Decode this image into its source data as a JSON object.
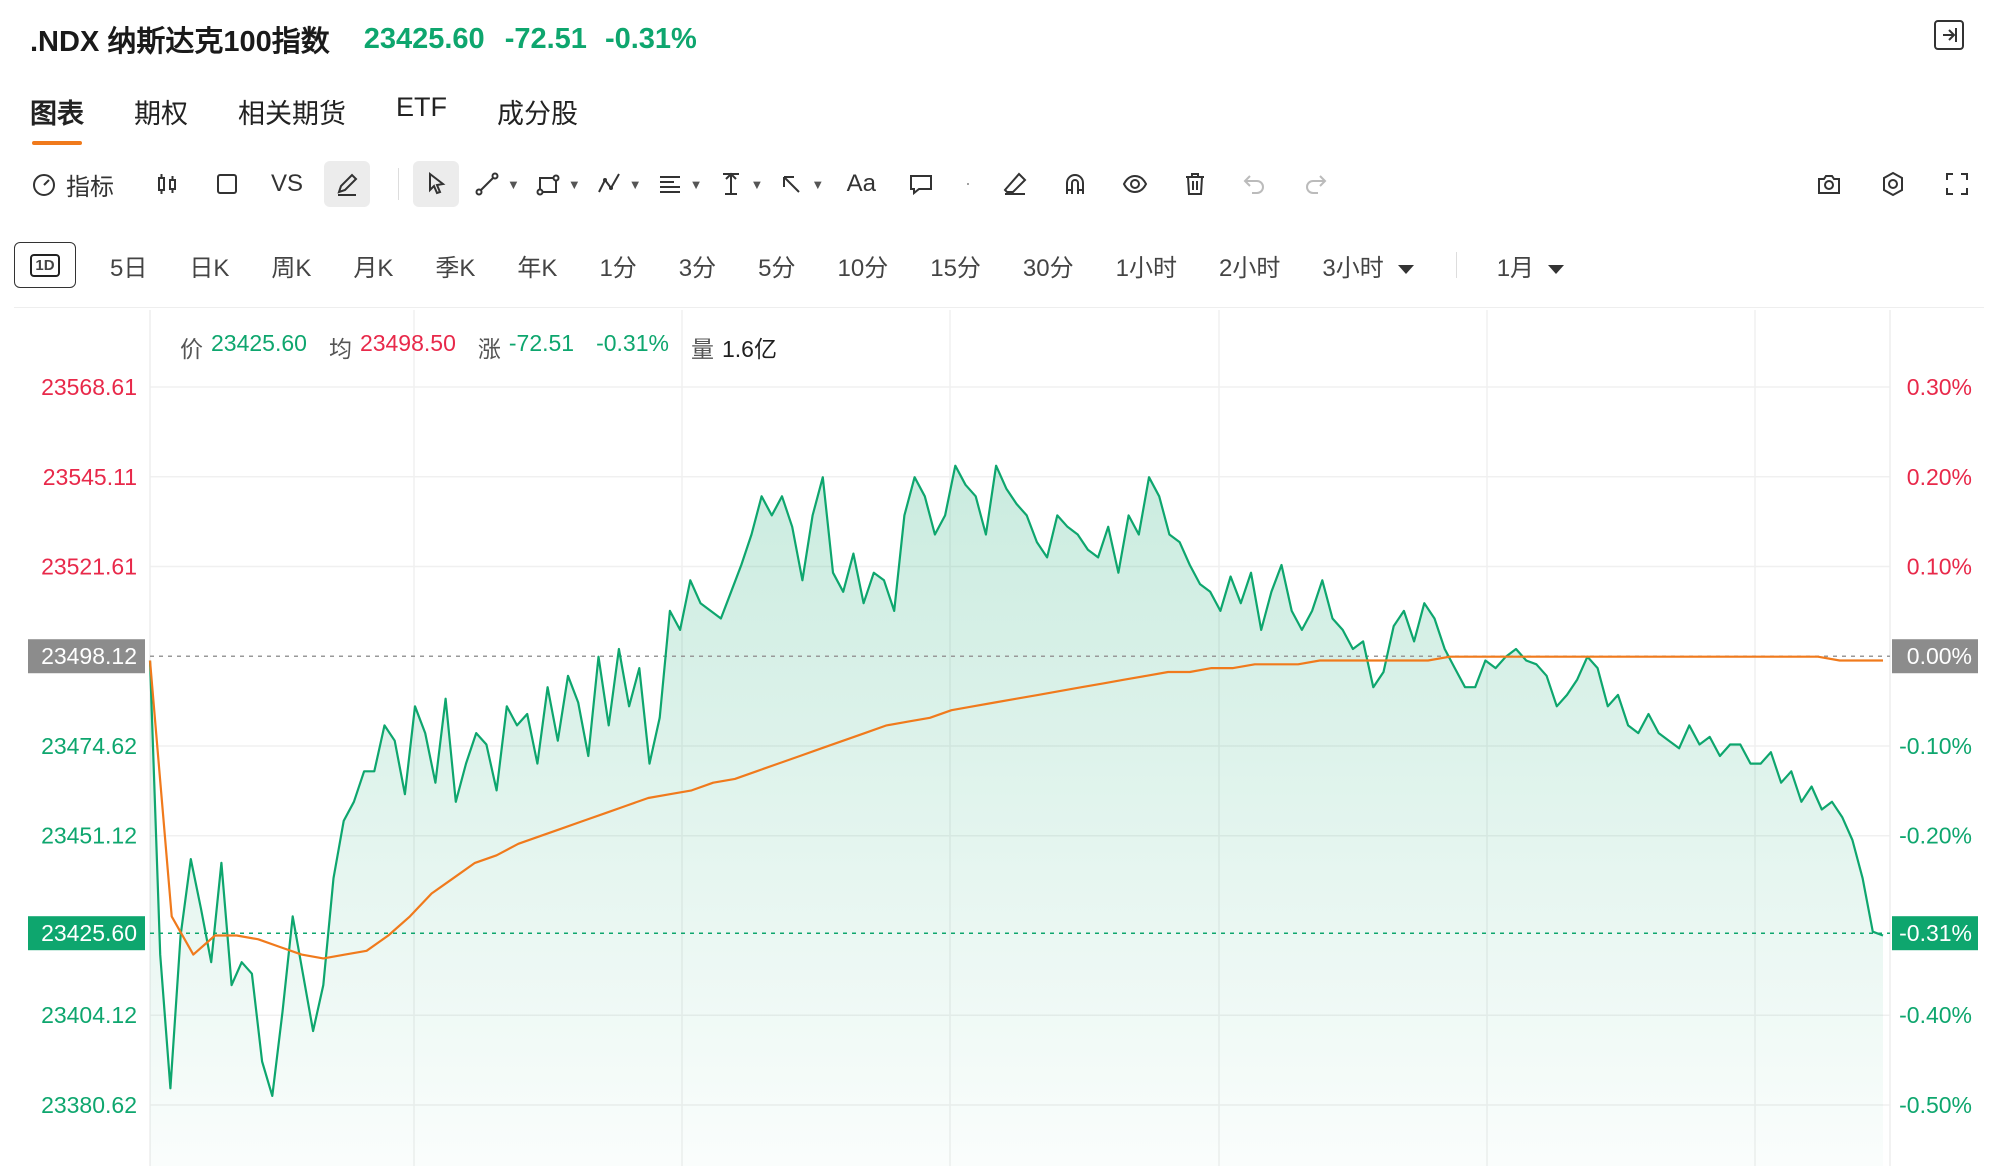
{
  "header": {
    "ticker": ".NDX 纳斯达克100指数",
    "price": "23425.60",
    "change": "-72.51",
    "change_pct": "-0.31%"
  },
  "tabs": [
    {
      "label": "图表",
      "active": true
    },
    {
      "label": "期权",
      "active": false
    },
    {
      "label": "相关期货",
      "active": false
    },
    {
      "label": "ETF",
      "active": false
    },
    {
      "label": "成分股",
      "active": false
    }
  ],
  "toolbar": {
    "indicator_label": "指标",
    "vs_label": "VS",
    "text_tool_label": "Aa"
  },
  "periods": [
    {
      "label": "1D",
      "active": true
    },
    {
      "label": "5日"
    },
    {
      "label": "日K"
    },
    {
      "label": "周K"
    },
    {
      "label": "月K"
    },
    {
      "label": "季K"
    },
    {
      "label": "年K"
    },
    {
      "label": "1分"
    },
    {
      "label": "3分"
    },
    {
      "label": "5分"
    },
    {
      "label": "10分"
    },
    {
      "label": "15分"
    },
    {
      "label": "30分"
    },
    {
      "label": "1小时"
    },
    {
      "label": "2小时"
    },
    {
      "label": "3小时"
    }
  ],
  "period_dropdown": "1月",
  "legend": {
    "price_label": "价",
    "price_value": "23425.60",
    "avg_label": "均",
    "avg_value": "23498.50",
    "chg_label": "涨",
    "chg_value": "-72.51",
    "chg_pct": "-0.31%",
    "vol_label": "量",
    "vol_value": "1.6亿"
  },
  "colors": {
    "up": "#e8294a",
    "down": "#0ea66e",
    "avg_line": "#f07a1c",
    "accent": "#f07a1c"
  },
  "chart_data": {
    "type": "area",
    "ylim": [
      23380.62,
      23568.61
    ],
    "prev_close": 23498.12,
    "last_price": 23425.6,
    "y_ticks_left": [
      "23568.61",
      "23545.11",
      "23521.61",
      "23498.12",
      "23474.62",
      "23451.12",
      "23425.60",
      "23404.12",
      "23380.62"
    ],
    "y_tick_values": [
      23568.61,
      23545.11,
      23521.61,
      23498.12,
      23474.62,
      23451.12,
      23425.6,
      23404.12,
      23380.62
    ],
    "y_ticks_right": [
      "0.30%",
      "0.20%",
      "0.10%",
      "0.00%",
      "-0.10%",
      "-0.20%",
      "-0.31%",
      "-0.40%",
      "-0.50%"
    ],
    "series": [
      {
        "values": [
          23497,
          23420,
          23385,
          23425,
          23445,
          23432,
          23418,
          23444,
          23412,
          23418,
          23415,
          23392,
          23383,
          23405,
          23430,
          23415,
          23400,
          23412,
          23440,
          23455,
          23460,
          23468,
          23468,
          23480,
          23476,
          23462,
          23485,
          23478,
          23465,
          23487,
          23460,
          23470,
          23478,
          23475,
          23463,
          23485,
          23480,
          23483,
          23470,
          23490,
          23476,
          23493,
          23486,
          23472,
          23498,
          23480,
          23500,
          23485,
          23495,
          23470,
          23482,
          23510,
          23505,
          23518,
          23512,
          23510,
          23508,
          23515,
          23522,
          23530,
          23540,
          23535,
          23540,
          23532,
          23518,
          23535,
          23545,
          23520,
          23515,
          23525,
          23512,
          23520,
          23518,
          23510,
          23535,
          23545,
          23540,
          23530,
          23535,
          23548,
          23543,
          23540,
          23530,
          23548,
          23542,
          23538,
          23535,
          23528,
          23524,
          23535,
          23532,
          23530,
          23526,
          23524,
          23532,
          23520,
          23535,
          23530,
          23545,
          23540,
          23530,
          23528,
          23522,
          23517,
          23515,
          23510,
          23519,
          23512,
          23520,
          23505,
          23515,
          23522,
          23510,
          23505,
          23510,
          23518,
          23508,
          23505,
          23500,
          23502,
          23490,
          23494,
          23506,
          23510,
          23502,
          23512,
          23508,
          23500,
          23495,
          23490,
          23490,
          23497,
          23495,
          23498,
          23500,
          23497,
          23496,
          23493,
          23485,
          23488,
          23492,
          23498,
          23495,
          23485,
          23488,
          23480,
          23478,
          23483,
          23478,
          23476,
          23474,
          23480,
          23475,
          23477,
          23472,
          23475,
          23475,
          23470,
          23470,
          23473,
          23465,
          23468,
          23460,
          23464,
          23458,
          23460,
          23456,
          23450,
          23440,
          23426,
          23425
        ]
      },
      {
        "values": [
          23497,
          23430,
          23420,
          23425,
          23425,
          23424,
          23422,
          23420,
          23419,
          23420,
          23421,
          23425,
          23430,
          23436,
          23440,
          23444,
          23446,
          23449,
          23451,
          23453,
          23455,
          23457,
          23459,
          23461,
          23462,
          23463,
          23465,
          23466,
          23468,
          23470,
          23472,
          23474,
          23476,
          23478,
          23480,
          23481,
          23482,
          23484,
          23485,
          23486,
          23487,
          23488,
          23489,
          23490,
          23491,
          23492,
          23493,
          23494,
          23494,
          23495,
          23495,
          23496,
          23496,
          23496,
          23497,
          23497,
          23497,
          23497,
          23497,
          23497,
          23498,
          23498,
          23498,
          23498,
          23498,
          23498,
          23498,
          23498,
          23498,
          23498,
          23498,
          23498,
          23498,
          23498,
          23498,
          23498,
          23498,
          23498,
          23497,
          23497,
          23497
        ]
      }
    ]
  }
}
